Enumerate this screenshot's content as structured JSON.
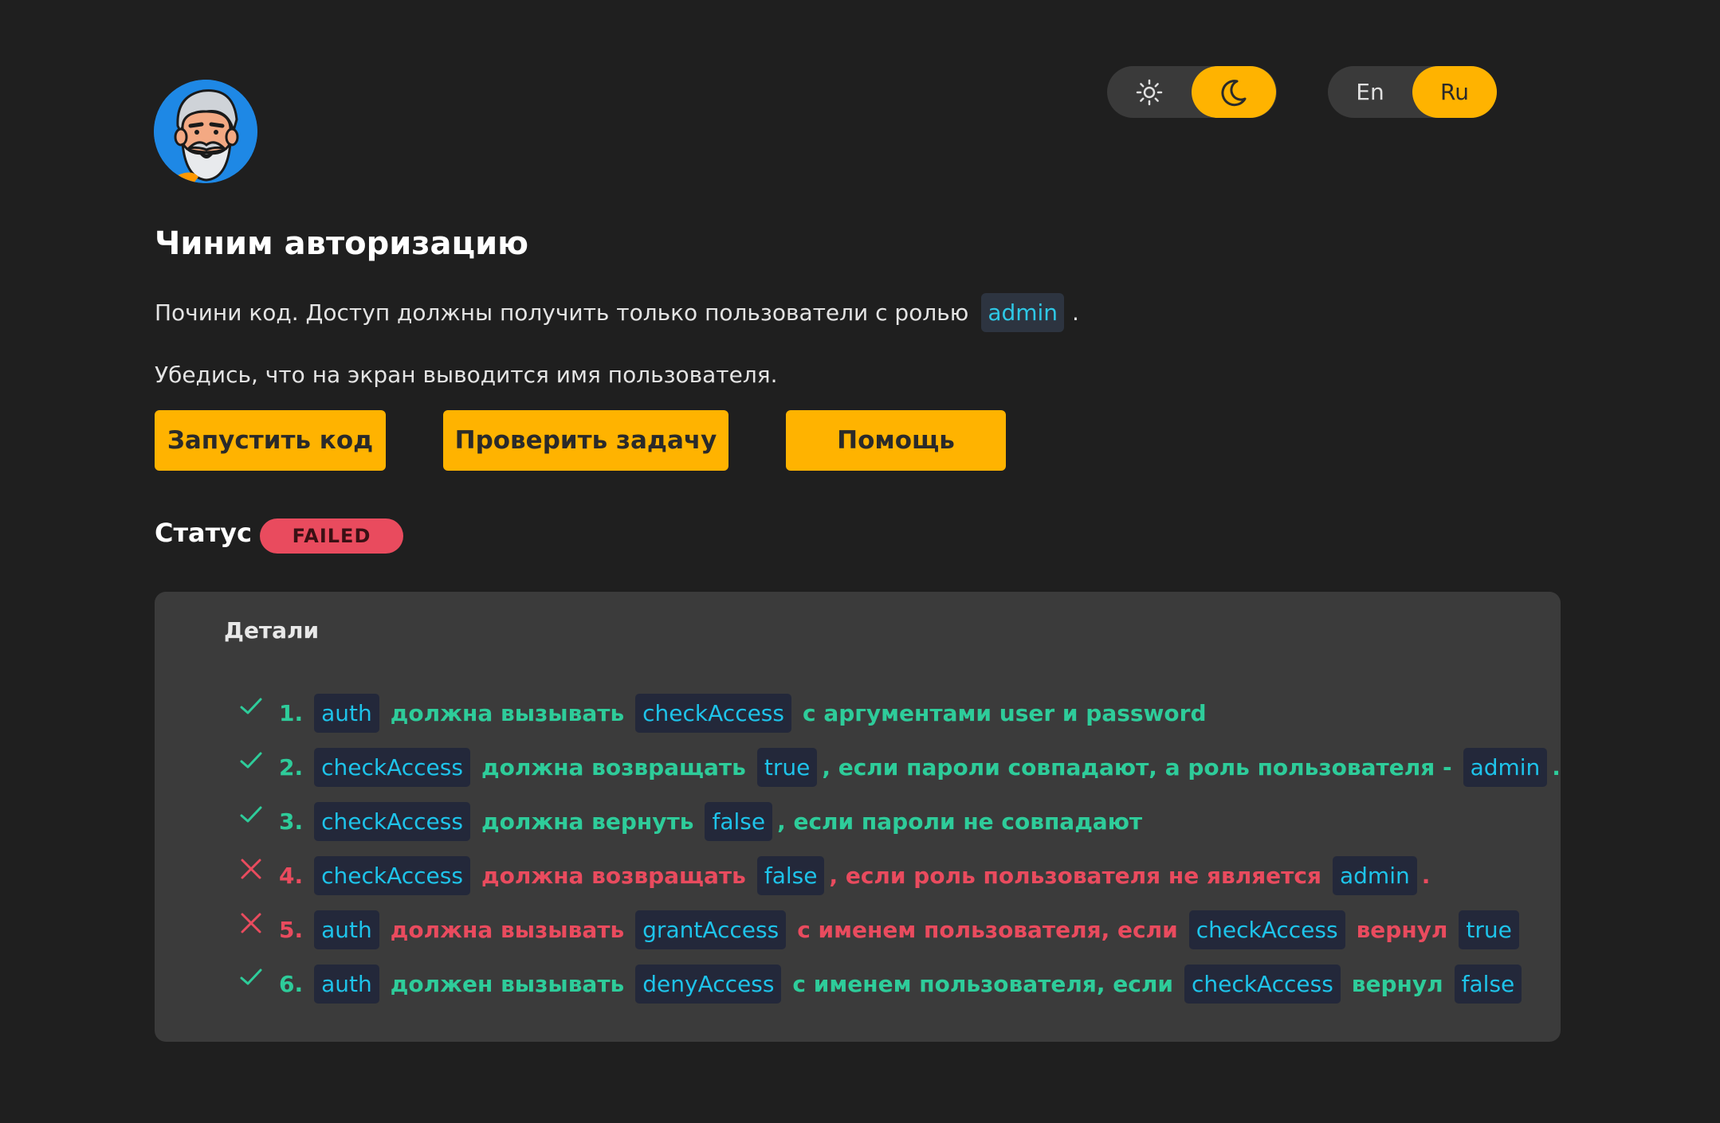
{
  "theme_toggle": {
    "options": [
      {
        "icon": "sun-icon",
        "active": false
      },
      {
        "icon": "moon-icon",
        "active": true
      }
    ]
  },
  "lang_toggle": {
    "options": [
      {
        "label": "En",
        "active": false
      },
      {
        "label": "Ru",
        "active": true
      }
    ]
  },
  "avatar": {
    "icon": "bearded-man-avatar"
  },
  "task": {
    "title": "Чиним авторизацию",
    "description_1_pre": "Почини код. Доступ должны получить только пользователи с ролью",
    "description_1_code": "admin",
    "description_1_post": ".",
    "description_2": "Убедись, что на экран выводится имя пользователя."
  },
  "buttons": {
    "run": "Запустить код",
    "check": "Проверить задачу",
    "help": "Помощь"
  },
  "status": {
    "label": "Статус",
    "value": "FAILED"
  },
  "details": {
    "title": "Детали",
    "checks": [
      {
        "num": "1.",
        "passed": true,
        "parts": [
          {
            "code": "auth"
          },
          {
            "text": "должна вызывать"
          },
          {
            "code": "checkAccess"
          },
          {
            "text": "с аргументами user и password"
          }
        ]
      },
      {
        "num": "2.",
        "passed": true,
        "parts": [
          {
            "code": "checkAccess"
          },
          {
            "text": "должна возвращать"
          },
          {
            "code": "true"
          },
          {
            "text": ", если пароли совпадают, а роль пользователя -"
          },
          {
            "code": "admin"
          },
          {
            "text": "."
          }
        ]
      },
      {
        "num": "3.",
        "passed": true,
        "parts": [
          {
            "code": "checkAccess"
          },
          {
            "text": "должна вернуть"
          },
          {
            "code": "false"
          },
          {
            "text": ", если пароли не совпадают"
          }
        ]
      },
      {
        "num": "4.",
        "passed": false,
        "parts": [
          {
            "code": "checkAccess"
          },
          {
            "text": "должна возвращать"
          },
          {
            "code": "false"
          },
          {
            "text": ", если роль пользователя не является"
          },
          {
            "code": "admin"
          },
          {
            "text": "."
          }
        ]
      },
      {
        "num": "5.",
        "passed": false,
        "parts": [
          {
            "code": "auth"
          },
          {
            "text": "должна вызывать"
          },
          {
            "code": "grantAccess"
          },
          {
            "text": "с именем пользователя, если"
          },
          {
            "code": "checkAccess"
          },
          {
            "text": "вернул"
          },
          {
            "code": "true"
          }
        ]
      },
      {
        "num": "6.",
        "passed": true,
        "parts": [
          {
            "code": "auth"
          },
          {
            "text": "должен вызывать"
          },
          {
            "code": "denyAccess"
          },
          {
            "text": "с именем пользователя, если"
          },
          {
            "code": "checkAccess"
          },
          {
            "text": "вернул"
          },
          {
            "code": "false"
          }
        ]
      }
    ]
  },
  "colors": {
    "accent": "#ffb300",
    "pass": "#2ecc9a",
    "fail": "#e94b5e",
    "code": "#1ec3ea"
  }
}
